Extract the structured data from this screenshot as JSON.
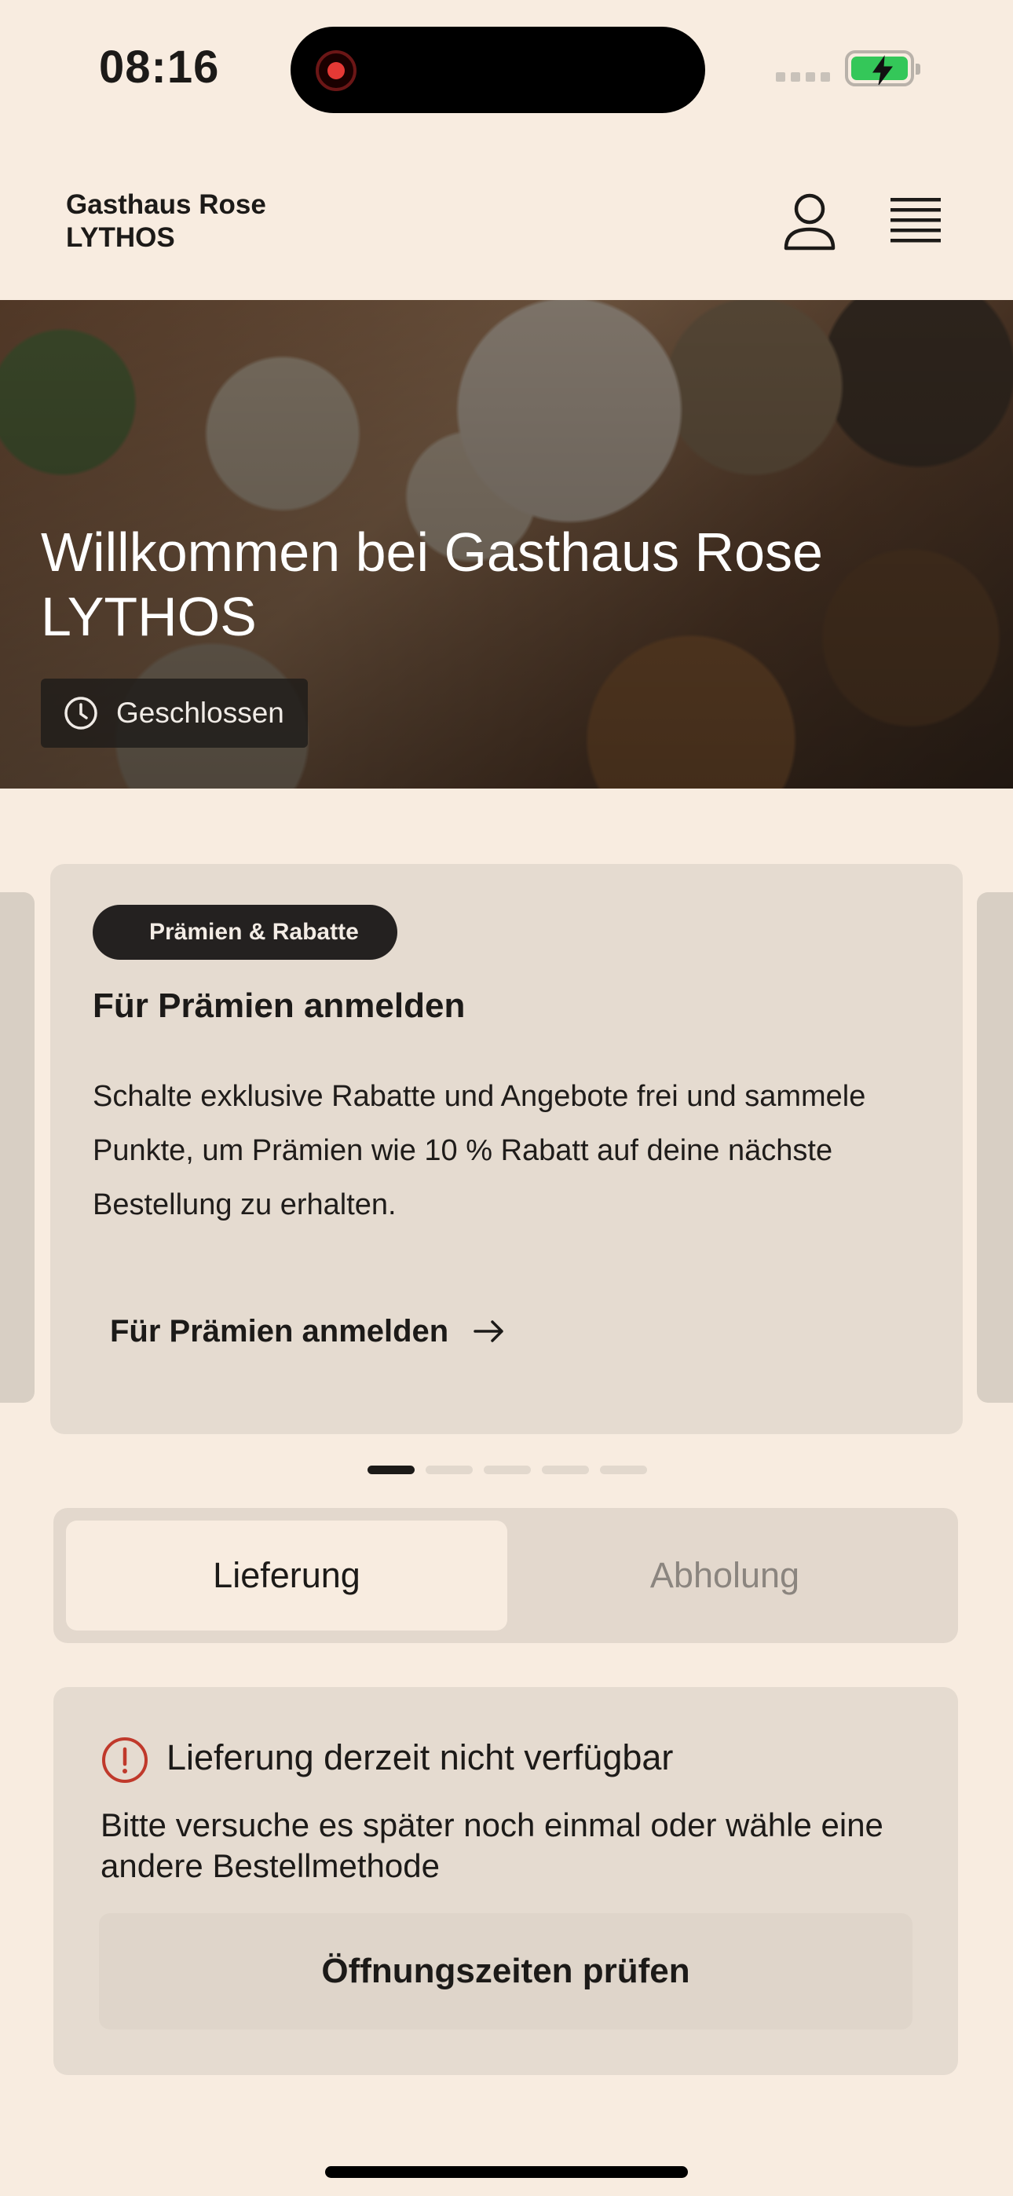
{
  "status_bar": {
    "time": "08:16"
  },
  "header": {
    "brand_line1": "Gasthaus Rose",
    "brand_line2": "LYTHOS"
  },
  "hero": {
    "title": "Willkommen bei Gasthaus Rose LYTHOS",
    "status": "Geschlossen"
  },
  "promo": {
    "tag": "Prämien & Rabatte",
    "title": "Für Prämien anmelden",
    "body": "Schalte exklusive Rabatte und Angebote frei und sammele Punkte, um Prämien wie 10 % Rabatt auf deine nächste Bestellung zu erhalten.",
    "link": "Für Prämien anmelden",
    "page_index": 1,
    "page_count": 5
  },
  "mode_toggle": {
    "options": [
      "Lieferung",
      "Abholung"
    ],
    "selected": "Lieferung"
  },
  "notice": {
    "title": "Lieferung derzeit nicht verfügbar",
    "text": "Bitte versuche es später noch einmal oder wähle eine andere Bestellmethode",
    "button": "Öffnungszeiten prüfen"
  },
  "colors": {
    "background": "#f8ece0",
    "card": "#e5dbd0",
    "dark": "#1c1a18",
    "error": "#c0392b",
    "battery": "#34c759"
  }
}
